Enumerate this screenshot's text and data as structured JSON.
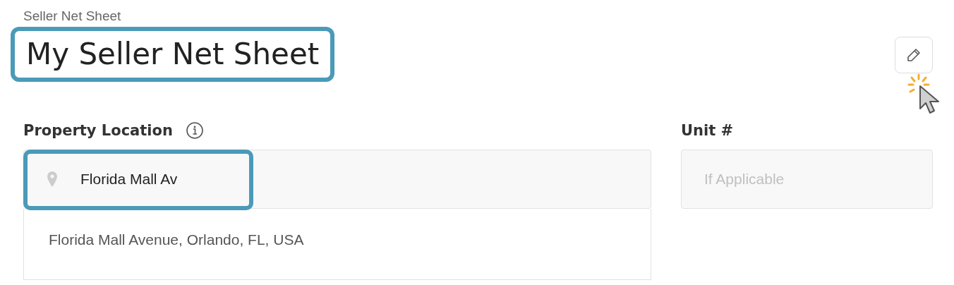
{
  "breadcrumb": "Seller Net Sheet",
  "title": {
    "text": "My Seller Net Sheet",
    "highlighted": true
  },
  "fields": [
    {
      "label": "Property Location",
      "kind": "location",
      "value": "Florida Mall Av",
      "highlighted": true,
      "suggestions": [
        "Florida Mall Avenue, Orlando, FL, USA"
      ]
    },
    {
      "label": "Unit #",
      "kind": "text",
      "placeholder": "If Applicable"
    }
  ]
}
